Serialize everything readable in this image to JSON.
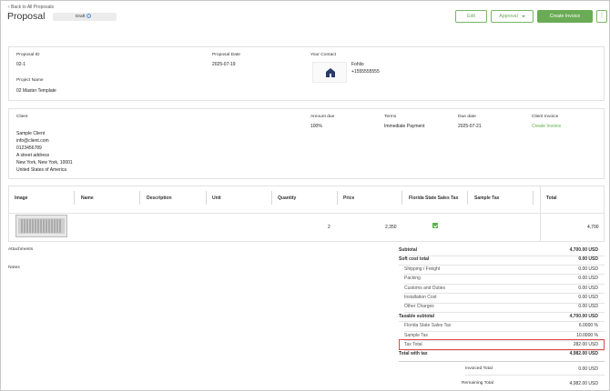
{
  "header": {
    "back_link": "‹ Back to All Proposals",
    "title": "Proposal",
    "status": "Draft",
    "status_icon": "info-icon",
    "buttons": {
      "edit": "Edit",
      "approval": "Approval",
      "create_invoice": "Create Invoice",
      "more": "⋮"
    }
  },
  "proposal_info": {
    "id_label": "Proposal ID",
    "id_value": "02-1",
    "date_label": "Proposal Date",
    "date_value": "2025-07-19",
    "contact_label": "Your Contact",
    "contact_name": "Fohlio",
    "contact_phone": "+1555555555",
    "project_label": "Project Name",
    "project_value": "02 Master Template"
  },
  "client_info": {
    "client_label": "Client",
    "client_lines": [
      "Sample Client",
      "info@client.com",
      "0123456789",
      "A street address",
      "New York, New York, 10001",
      "United States of America"
    ],
    "amount_due_label": "Amount due",
    "amount_due_value": "100%",
    "terms_label": "Terms",
    "terms_value": "Immediate Payment",
    "due_date_label": "Due date",
    "due_date_value": "2025-07-21",
    "client_invoice_label": "Client Invoice",
    "client_invoice_link": "Create Invoice"
  },
  "table": {
    "columns": [
      "Image",
      "Name",
      "Description",
      "Unit",
      "Quantity",
      "Price",
      "Florida State Sales Tax",
      "Sample Tax",
      "Total"
    ],
    "rows": [
      {
        "name": "",
        "description": "",
        "unit": "",
        "quantity": "2",
        "price": "2,350",
        "florida_tax_checked": true,
        "sample_tax": "",
        "total": "4,700"
      }
    ]
  },
  "side_sections": {
    "attachments": "Attachments",
    "notes": "Notes"
  },
  "summary": [
    {
      "label": "Subtotal",
      "value": "4,700.00 USD",
      "style": "bold"
    },
    {
      "label": "Soft cost total",
      "value": "0.00 USD",
      "style": "bold"
    },
    {
      "label": "Shipping / Freight",
      "value": "0.00 USD",
      "style": "sub"
    },
    {
      "label": "Packing",
      "value": "0.00 USD",
      "style": "sub"
    },
    {
      "label": "Customs and Duties",
      "value": "0.00 USD",
      "style": "sub"
    },
    {
      "label": "Installation Cost",
      "value": "0.00 USD",
      "style": "sub"
    },
    {
      "label": "Other Charges",
      "value": "0.00 USD",
      "style": "sub"
    },
    {
      "label": "Taxable subtotal",
      "value": "4,700.00 USD",
      "style": "bold"
    },
    {
      "label": "Florida State Sales Tax",
      "value": "6.0000 %",
      "style": "sub"
    },
    {
      "label": "Sample Tax",
      "value": "10.0000 %",
      "style": "sub"
    },
    {
      "label": "Tax Total",
      "value": "282.00 USD",
      "style": "sub"
    },
    {
      "label": "Total with tax",
      "value": "4,982.00 USD",
      "style": "bold"
    }
  ],
  "invoiced_total": {
    "label": "Invoiced Total",
    "value": "0.00 USD"
  },
  "remaining_total": {
    "label": "Remaining Total",
    "value": "4,982.00 USD"
  },
  "colors": {
    "accent_green": "#6aab55",
    "highlight_red": "#e54848"
  }
}
